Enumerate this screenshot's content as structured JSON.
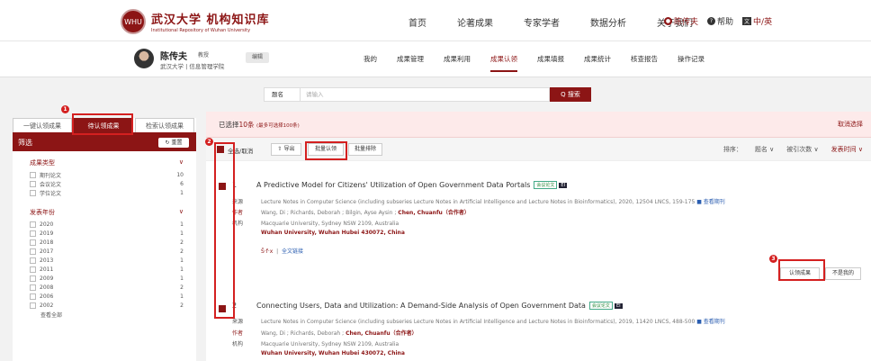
{
  "header": {
    "logo_seal": "WHU",
    "logo_title": "武汉大学 机构知识库",
    "logo_subtitle": "Institutional Repository of Wuhan University",
    "nav": [
      "首页",
      "论著成果",
      "专家学者",
      "数据分析",
      "关于我们"
    ],
    "user_link": "陈传夫",
    "help": "帮助",
    "lang": "中/英"
  },
  "user": {
    "name": "陈传夫",
    "role": "教授",
    "affiliation": "武汉大学 | 信息管理学院",
    "edit_label": "编辑",
    "subnav": [
      "我的",
      "成果管理",
      "成果利用",
      "成果认领",
      "成果填报",
      "成果统计",
      "核查报告",
      "操作记录"
    ],
    "active_subnav": "成果认领"
  },
  "search": {
    "field_label": "题名",
    "placeholder": "请输入",
    "button": "Q 搜索"
  },
  "left": {
    "tabs": [
      "一键认领成果",
      "待认领成果",
      "检索认领成果"
    ],
    "active_tab": "待认领成果",
    "filter_title": "筛选",
    "reset": "↻ 重置",
    "type_title": "成果类型",
    "types": [
      {
        "label": "期刊论文",
        "count": "10"
      },
      {
        "label": "会议论文",
        "count": "6"
      },
      {
        "label": "学位论文",
        "count": "1"
      }
    ],
    "year_title": "发表年份",
    "years": [
      {
        "label": "2020",
        "count": "1"
      },
      {
        "label": "2019",
        "count": "1"
      },
      {
        "label": "2018",
        "count": "2"
      },
      {
        "label": "2017",
        "count": "2"
      },
      {
        "label": "2013",
        "count": "1"
      },
      {
        "label": "2011",
        "count": "1"
      },
      {
        "label": "2009",
        "count": "1"
      },
      {
        "label": "2008",
        "count": "2"
      },
      {
        "label": "2006",
        "count": "1"
      },
      {
        "label": "2002",
        "count": "2"
      }
    ],
    "more": "查看全部"
  },
  "selection": {
    "prefix": "已选择",
    "count": "10条",
    "note": "(最多可选择100条)",
    "cancel": "取消选择"
  },
  "toolbar": {
    "select_all": "全选/取消",
    "export": "导出",
    "batch_claim": "批量认领",
    "batch_exclude": "批量排除",
    "sort_label": "排序：",
    "sort_options": [
      "题名 ∨",
      "被引次数 ∨",
      "发表时间 ∨"
    ]
  },
  "items": [
    {
      "num": "1",
      "title": "A Predictive Model for Citizens' Utilization of Open Government Data Portals",
      "type_tag": "会议论文",
      "index_tag": "EI",
      "source_key": "来源",
      "source": "Lecture Notes in Computer Science (including subseries Lecture Notes in Artificial Intelligence and Lecture Notes in Bioinformatics), 2020, 12504 LNCS, 159-175",
      "source_link": "■ 查看期刊",
      "authors_key": "作者",
      "authors": "Wang, Di ; Richards, Deborah ; Bilgin, Ayse Aysin ;",
      "me": "Chen, Chuanfu（合作者）",
      "org_key": "机构",
      "org1": "Macquarie University, Sydney NSW 2109, Australia",
      "org2": "Wuhan University, Wuhan Hubei 430072, China",
      "fulltext": "全文链接",
      "claim": "认领成果",
      "notme": "不是我的"
    },
    {
      "num": "2",
      "title": "Connecting Users, Data and Utilization: A Demand-Side Analysis of Open Government Data",
      "type_tag": "会议论文",
      "index_tag": "EI",
      "source_key": "来源",
      "source": "Lecture Notes in Computer Science (including subseries Lecture Notes in Artificial Intelligence and Lecture Notes in Bioinformatics), 2019, 11420 LNCS, 488-500",
      "source_link": "■ 查看期刊",
      "authors_key": "作者",
      "authors": "Wang, Di ; Richards, Deborah ;",
      "me": "Chen, Chuanfu（合作者）",
      "org_key": "机构",
      "org1": "Macquarie University, Sydney NSW 2109, Australia",
      "org2": "Wuhan University, Wuhan Hubei 430072, China"
    }
  ],
  "markers": [
    "1",
    "2",
    "3"
  ],
  "colors": {
    "brand": "#8c1515",
    "highlight": "#d42020"
  }
}
